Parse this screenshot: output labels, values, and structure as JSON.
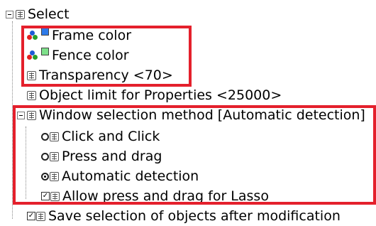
{
  "tree": {
    "root_label": "Select",
    "frame_color_label": "Frame color",
    "fence_color_label": "Fence color",
    "transparency_label": "Transparency <70>",
    "object_limit_label": "Object limit for Properties <25000>",
    "window_selection_label": "Window selection method [Automatic detection]",
    "options": [
      {
        "label": "Click and Click",
        "selected": false
      },
      {
        "label": "Press and drag",
        "selected": false
      },
      {
        "label": "Automatic detection",
        "selected": true
      },
      {
        "label": "Allow press and drag for Lasso",
        "checked": true
      }
    ],
    "save_selection_label": "Save selection of objects after modification"
  },
  "colors": {
    "frame_swatch": "#2e7bea",
    "fence_swatch": "#7ee08a",
    "highlight": "#e4202c"
  }
}
